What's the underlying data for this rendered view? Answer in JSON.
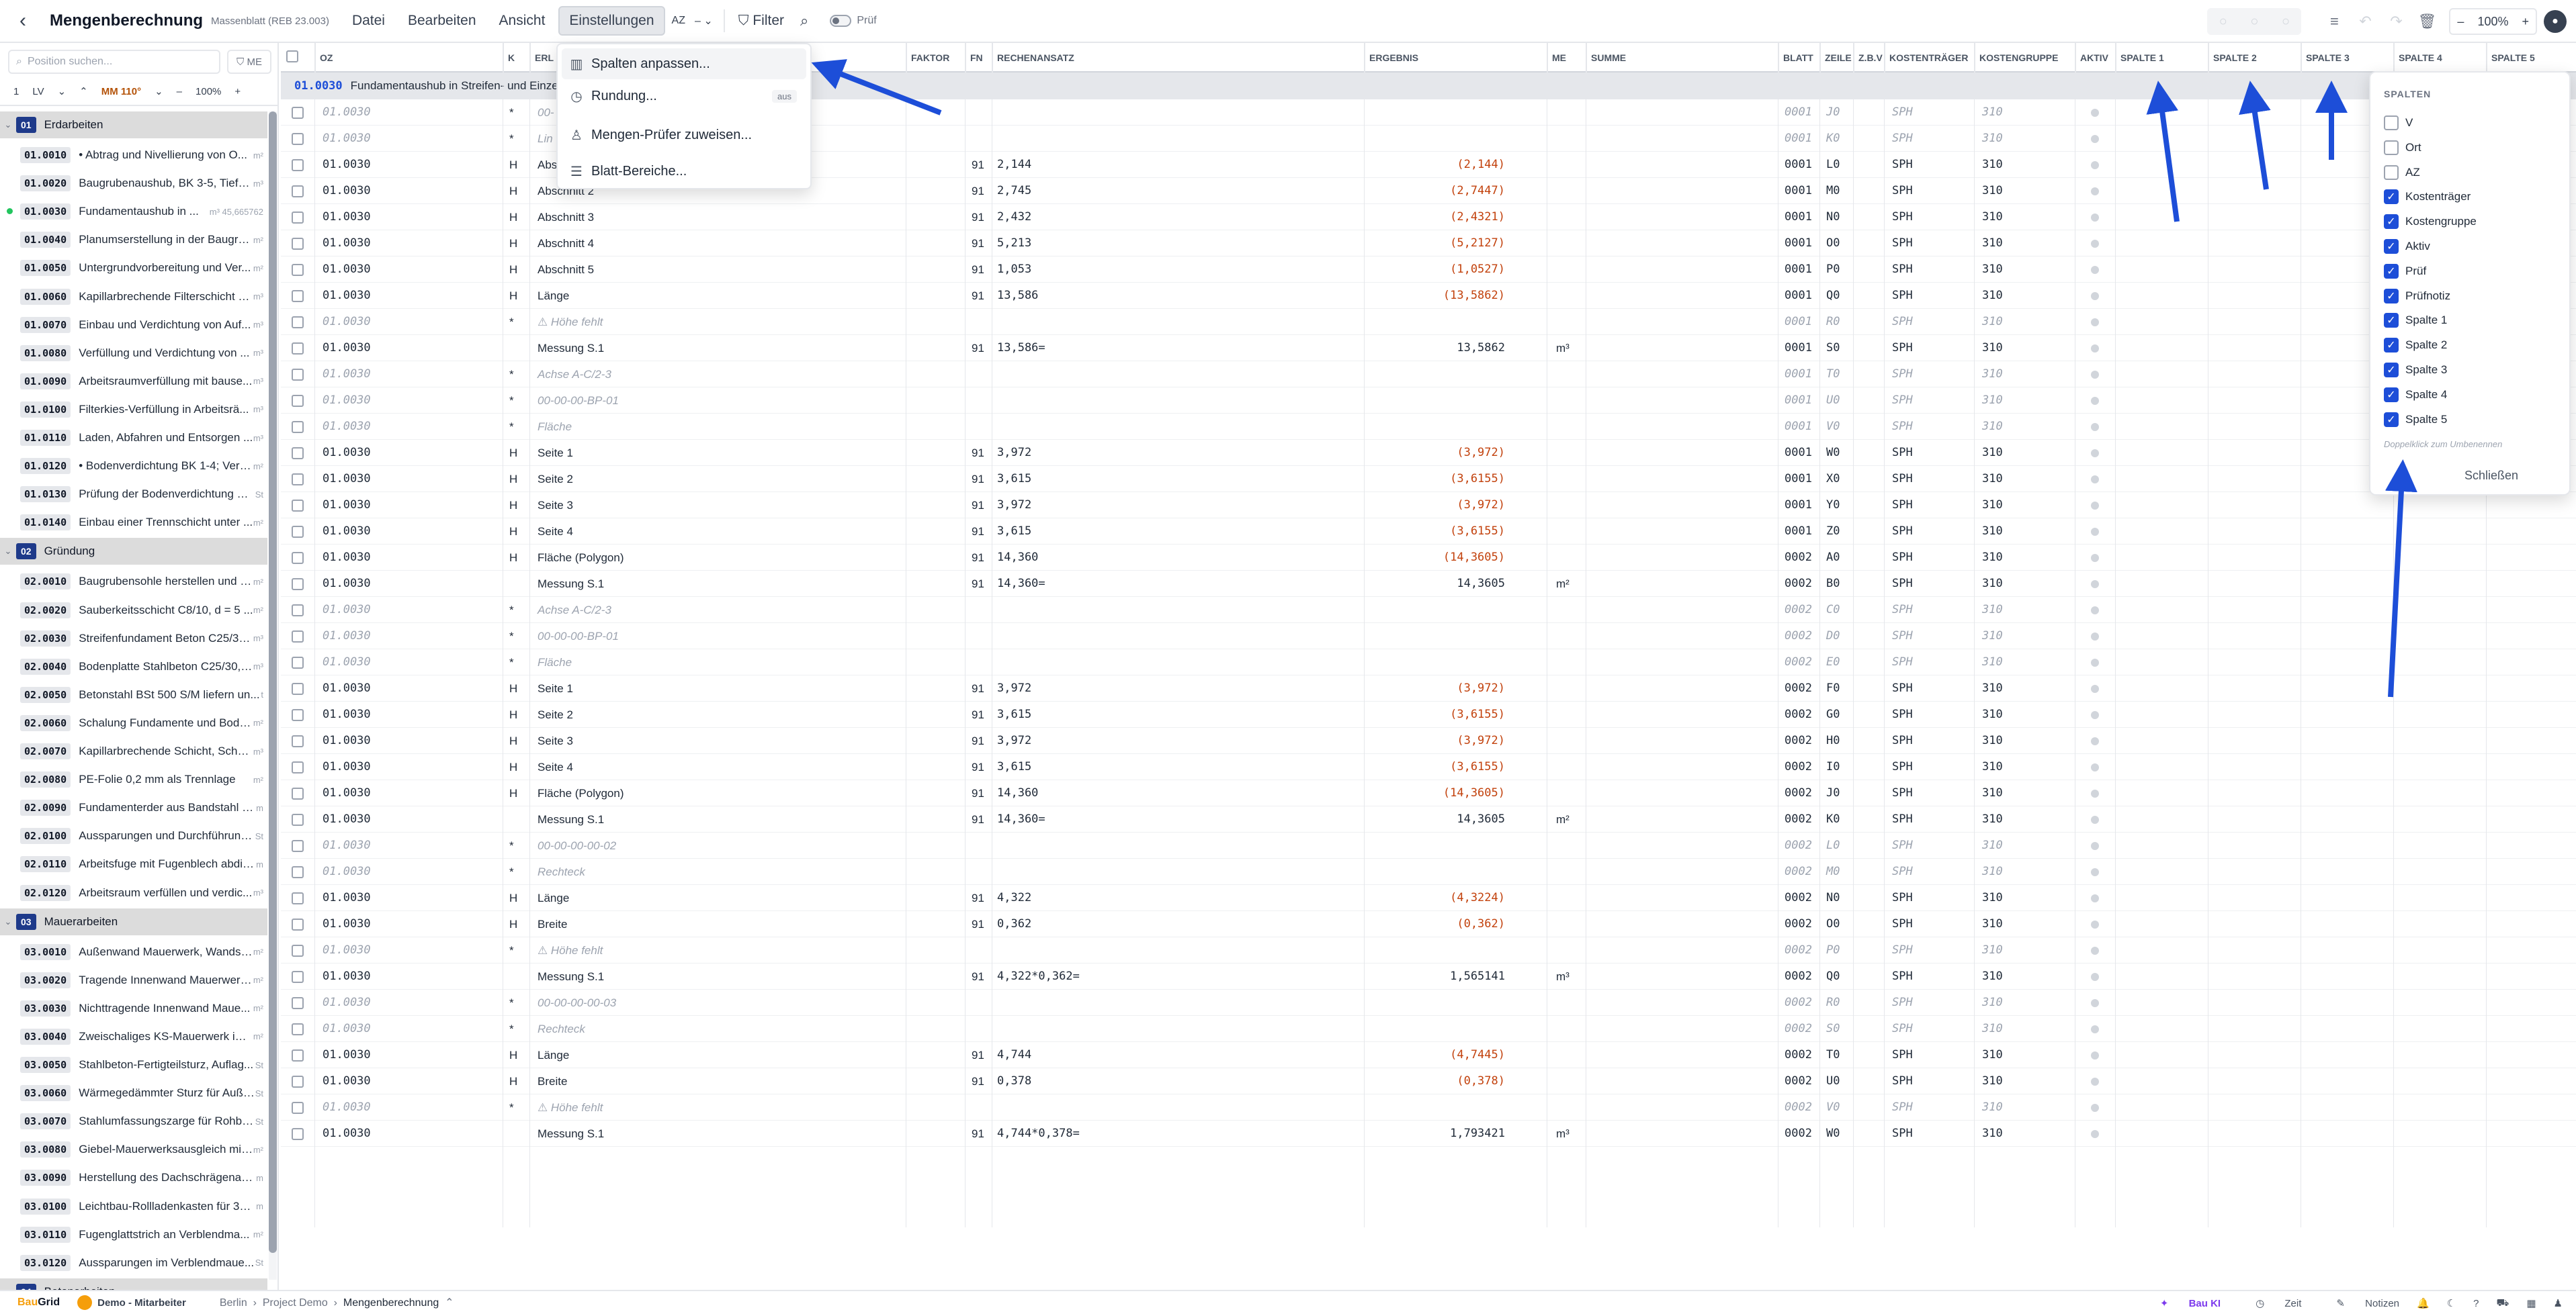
{
  "toolbar": {
    "title": "Mengenberechnung",
    "subtitle": "Massenblatt (REB 23.003)",
    "menus": [
      "Datei",
      "Bearbeiten",
      "Ansicht",
      "Einstellungen"
    ],
    "az_label": "AZ",
    "az_value": "–",
    "filter_label": "Filter",
    "pruef_label": "Prüf",
    "zoom": "100%"
  },
  "dropdown": {
    "items": [
      {
        "label": "Spalten anpassen...",
        "icon": "columns-icon"
      },
      {
        "label": "Rundung...",
        "icon": "clock-icon",
        "badge": "aus"
      },
      {
        "label": "Mengen-Prüfer zuweisen...",
        "icon": "user-icon"
      },
      {
        "label": "Blatt-Bereiche...",
        "icon": "list-icon"
      }
    ]
  },
  "sidebar": {
    "search_placeholder": "Position suchen...",
    "me_label": "ME",
    "nav": {
      "first": "1",
      "lv": "LV",
      "mm": "MM 110°",
      "minus": "–",
      "zoom": "100%",
      "plus": "+"
    },
    "sections": [
      {
        "num": "01",
        "title": "Erdarbeiten",
        "items": [
          {
            "oz": "01.0010",
            "text": "• Abtrag und Nivellierung von O...",
            "unit": "m²"
          },
          {
            "oz": "01.0020",
            "text": "Baugrubenaushub, BK 3-5, Tiefe ...",
            "unit": "m³"
          },
          {
            "oz": "01.0030",
            "text": "Fundamentaushub in ...",
            "unit": "m³ 45,665762",
            "dot": true
          },
          {
            "oz": "01.0040",
            "text": "Planumserstellung in der Baugru...",
            "unit": "m²"
          },
          {
            "oz": "01.0050",
            "text": "Untergrundvorbereitung und Ver...",
            "unit": "m²"
          },
          {
            "oz": "01.0060",
            "text": "Kapillarbrechende Filterschicht a...",
            "unit": "m³"
          },
          {
            "oz": "01.0070",
            "text": "Einbau und Verdichtung von Auf...",
            "unit": "m³"
          },
          {
            "oz": "01.0080",
            "text": "Verfüllung und Verdichtung von ...",
            "unit": "m³"
          },
          {
            "oz": "01.0090",
            "text": "Arbeitsraumverfüllung mit bause...",
            "unit": "m³"
          },
          {
            "oz": "01.0100",
            "text": "Filterkies-Verfüllung in Arbeitsrä...",
            "unit": "m³"
          },
          {
            "oz": "01.0110",
            "text": "Laden, Abfahren und Entsorgen ...",
            "unit": "m³"
          },
          {
            "oz": "01.0120",
            "text": "• Bodenverdichtung BK 1-4; Verk...",
            "unit": "m²"
          },
          {
            "oz": "01.0130",
            "text": "Prüfung der Bodenverdichtung m...",
            "unit": "St"
          },
          {
            "oz": "01.0140",
            "text": "Einbau einer Trennschicht unter ...",
            "unit": "m²"
          }
        ]
      },
      {
        "num": "02",
        "title": "Gründung",
        "items": [
          {
            "oz": "02.0010",
            "text": "Baugrubensohle herstellen und v...",
            "unit": "m²"
          },
          {
            "oz": "02.0020",
            "text": "Sauberkeitsschicht C8/10, d = 5 ...",
            "unit": "m²"
          },
          {
            "oz": "02.0030",
            "text": "Streifenfundament Beton C25/30...",
            "unit": "m³"
          },
          {
            "oz": "02.0040",
            "text": "Bodenplatte Stahlbeton C25/30, ...",
            "unit": "m³"
          },
          {
            "oz": "02.0050",
            "text": "Betonstahl BSt 500 S/M liefern un...",
            "unit": "t"
          },
          {
            "oz": "02.0060",
            "text": "Schalung Fundamente und Bode...",
            "unit": "m²"
          },
          {
            "oz": "02.0070",
            "text": "Kapillarbrechende Schicht, Schot...",
            "unit": "m³"
          },
          {
            "oz": "02.0080",
            "text": "PE-Folie 0,2 mm als Trennlage",
            "unit": "m²"
          },
          {
            "oz": "02.0090",
            "text": "Fundamenterder aus Bandstahl 3...",
            "unit": "m"
          },
          {
            "oz": "02.0100",
            "text": "Aussparungen und Durchführung...",
            "unit": "St"
          },
          {
            "oz": "02.0110",
            "text": "Arbeitsfuge mit Fugenblech abdic...",
            "unit": "m"
          },
          {
            "oz": "02.0120",
            "text": "Arbeitsraum verfüllen und verdic...",
            "unit": "m³"
          }
        ]
      },
      {
        "num": "03",
        "title": "Mauerarbeiten",
        "items": [
          {
            "oz": "03.0010",
            "text": "Außenwand Mauerwerk, Wandst...",
            "unit": "m²"
          },
          {
            "oz": "03.0020",
            "text": "Tragende Innenwand Mauerwerk...",
            "unit": "m²"
          },
          {
            "oz": "03.0030",
            "text": "Nichttragende Innenwand Maue...",
            "unit": "m²"
          },
          {
            "oz": "03.0040",
            "text": "Zweischaliges KS-Mauerwerk im ...",
            "unit": "m²"
          },
          {
            "oz": "03.0050",
            "text": "Stahlbeton-Fertigteilsturz, Auflag...",
            "unit": "St"
          },
          {
            "oz": "03.0060",
            "text": "Wärmegedämmter Sturz für Auße...",
            "unit": "St"
          },
          {
            "oz": "03.0070",
            "text": "Stahlumfassungszarge für Rohba...",
            "unit": "St"
          },
          {
            "oz": "03.0080",
            "text": "Giebel-Mauerwerksausgleich mit ...",
            "unit": "m²"
          },
          {
            "oz": "03.0090",
            "text": "Herstellung des Dachschrägenans...",
            "unit": "m"
          },
          {
            "oz": "03.0100",
            "text": "Leichtbau-Rollladenkasten für 30 ...",
            "unit": "m"
          },
          {
            "oz": "03.0110",
            "text": "Fugenglattstrich an Verblendma...",
            "unit": "m²"
          },
          {
            "oz": "03.0120",
            "text": "Aussparungen im Verblendmaue...",
            "unit": "St"
          }
        ]
      },
      {
        "num": "04",
        "title": "Betonarbeiten",
        "items": []
      }
    ]
  },
  "grid": {
    "columns": [
      "OZ",
      "K",
      "ERL",
      "FAKTOR",
      "FN",
      "RECHENANSATZ",
      "ERGEBNIS",
      "ME",
      "SUMME",
      "BLATT",
      "ZEILE",
      "Z.B.V",
      "KOSTENTRÄGER",
      "KOSTENGRUPPE",
      "AKTIV",
      "SPALTE 1",
      "SPALTE 2",
      "SPALTE 3",
      "SPALTE 4",
      "SPALTE 5"
    ],
    "group": {
      "oz": "01.0030",
      "title": "Fundamentaushub in Streifen- und Einze"
    },
    "rows": [
      {
        "oz": "01.0030",
        "k": "*",
        "erl": "00-",
        "fn": "",
        "ansatz": "",
        "erg": "",
        "me": "",
        "blatt": "0001",
        "zeile": "J0",
        "kt": "SPH",
        "kg": "310",
        "c": 1
      },
      {
        "oz": "01.0030",
        "k": "*",
        "erl": "Lin",
        "fn": "",
        "ansatz": "",
        "erg": "",
        "me": "",
        "blatt": "0001",
        "zeile": "K0",
        "kt": "SPH",
        "kg": "310",
        "c": 1
      },
      {
        "oz": "01.0030",
        "k": "H",
        "erl": "Abs",
        "fn": "91",
        "ansatz": "2,144",
        "erg": "(2,144)",
        "me": "",
        "blatt": "0001",
        "zeile": "L0",
        "kt": "SPH",
        "kg": "310",
        "o": 1
      },
      {
        "oz": "01.0030",
        "k": "H",
        "erl": "Abschnitt 2",
        "fn": "91",
        "ansatz": "2,745",
        "erg": "(2,7447)",
        "me": "",
        "blatt": "0001",
        "zeile": "M0",
        "kt": "SPH",
        "kg": "310",
        "o": 1
      },
      {
        "oz": "01.0030",
        "k": "H",
        "erl": "Abschnitt 3",
        "fn": "91",
        "ansatz": "2,432",
        "erg": "(2,4321)",
        "me": "",
        "blatt": "0001",
        "zeile": "N0",
        "kt": "SPH",
        "kg": "310",
        "o": 1
      },
      {
        "oz": "01.0030",
        "k": "H",
        "erl": "Abschnitt 4",
        "fn": "91",
        "ansatz": "5,213",
        "erg": "(5,2127)",
        "me": "",
        "blatt": "0001",
        "zeile": "O0",
        "kt": "SPH",
        "kg": "310",
        "o": 1
      },
      {
        "oz": "01.0030",
        "k": "H",
        "erl": "Abschnitt 5",
        "fn": "91",
        "ansatz": "1,053",
        "erg": "(1,0527)",
        "me": "",
        "blatt": "0001",
        "zeile": "P0",
        "kt": "SPH",
        "kg": "310",
        "o": 1
      },
      {
        "oz": "01.0030",
        "k": "H",
        "erl": "Länge",
        "fn": "91",
        "ansatz": "13,586",
        "erg": "(13,5862)",
        "me": "",
        "blatt": "0001",
        "zeile": "Q0",
        "kt": "SPH",
        "kg": "310",
        "o": 1
      },
      {
        "oz": "01.0030",
        "k": "*",
        "erl": "⚠ Höhe fehlt",
        "fn": "",
        "ansatz": "",
        "erg": "",
        "me": "",
        "blatt": "0001",
        "zeile": "R0",
        "kt": "SPH",
        "kg": "310",
        "c": 1
      },
      {
        "oz": "01.0030",
        "k": "",
        "erl": "Messung S.1",
        "fn": "91",
        "ansatz": "13,586=",
        "erg": "13,5862",
        "me": "m³",
        "blatt": "0001",
        "zeile": "S0",
        "kt": "SPH",
        "kg": "310"
      },
      {
        "oz": "01.0030",
        "k": "*",
        "erl": "Achse A-C/2-3",
        "fn": "",
        "ansatz": "",
        "erg": "",
        "me": "",
        "blatt": "0001",
        "zeile": "T0",
        "kt": "SPH",
        "kg": "310",
        "c": 1
      },
      {
        "oz": "01.0030",
        "k": "*",
        "erl": "00-00-00-BP-01",
        "fn": "",
        "ansatz": "",
        "erg": "",
        "me": "",
        "blatt": "0001",
        "zeile": "U0",
        "kt": "SPH",
        "kg": "310",
        "c": 1
      },
      {
        "oz": "01.0030",
        "k": "*",
        "erl": "Fläche",
        "fn": "",
        "ansatz": "",
        "erg": "",
        "me": "",
        "blatt": "0001",
        "zeile": "V0",
        "kt": "SPH",
        "kg": "310",
        "c": 1
      },
      {
        "oz": "01.0030",
        "k": "H",
        "erl": "Seite 1",
        "fn": "91",
        "ansatz": "3,972",
        "erg": "(3,972)",
        "me": "",
        "blatt": "0001",
        "zeile": "W0",
        "kt": "SPH",
        "kg": "310",
        "o": 1
      },
      {
        "oz": "01.0030",
        "k": "H",
        "erl": "Seite 2",
        "fn": "91",
        "ansatz": "3,615",
        "erg": "(3,6155)",
        "me": "",
        "blatt": "0001",
        "zeile": "X0",
        "kt": "SPH",
        "kg": "310",
        "o": 1
      },
      {
        "oz": "01.0030",
        "k": "H",
        "erl": "Seite 3",
        "fn": "91",
        "ansatz": "3,972",
        "erg": "(3,972)",
        "me": "",
        "blatt": "0001",
        "zeile": "Y0",
        "kt": "SPH",
        "kg": "310",
        "o": 1
      },
      {
        "oz": "01.0030",
        "k": "H",
        "erl": "Seite 4",
        "fn": "91",
        "ansatz": "3,615",
        "erg": "(3,6155)",
        "me": "",
        "blatt": "0001",
        "zeile": "Z0",
        "kt": "SPH",
        "kg": "310",
        "o": 1
      },
      {
        "oz": "01.0030",
        "k": "H",
        "erl": "Fläche (Polygon)",
        "fn": "91",
        "ansatz": "14,360",
        "erg": "(14,3605)",
        "me": "",
        "blatt": "0002",
        "zeile": "A0",
        "kt": "SPH",
        "kg": "310",
        "o": 1
      },
      {
        "oz": "01.0030",
        "k": "",
        "erl": "Messung S.1",
        "fn": "91",
        "ansatz": "14,360=",
        "erg": "14,3605",
        "me": "m²",
        "blatt": "0002",
        "zeile": "B0",
        "kt": "SPH",
        "kg": "310"
      },
      {
        "oz": "01.0030",
        "k": "*",
        "erl": "Achse A-C/2-3",
        "fn": "",
        "ansatz": "",
        "erg": "",
        "me": "",
        "blatt": "0002",
        "zeile": "C0",
        "kt": "SPH",
        "kg": "310",
        "c": 1
      },
      {
        "oz": "01.0030",
        "k": "*",
        "erl": "00-00-00-BP-01",
        "fn": "",
        "ansatz": "",
        "erg": "",
        "me": "",
        "blatt": "0002",
        "zeile": "D0",
        "kt": "SPH",
        "kg": "310",
        "c": 1
      },
      {
        "oz": "01.0030",
        "k": "*",
        "erl": "Fläche",
        "fn": "",
        "ansatz": "",
        "erg": "",
        "me": "",
        "blatt": "0002",
        "zeile": "E0",
        "kt": "SPH",
        "kg": "310",
        "c": 1
      },
      {
        "oz": "01.0030",
        "k": "H",
        "erl": "Seite 1",
        "fn": "91",
        "ansatz": "3,972",
        "erg": "(3,972)",
        "me": "",
        "blatt": "0002",
        "zeile": "F0",
        "kt": "SPH",
        "kg": "310",
        "o": 1
      },
      {
        "oz": "01.0030",
        "k": "H",
        "erl": "Seite 2",
        "fn": "91",
        "ansatz": "3,615",
        "erg": "(3,6155)",
        "me": "",
        "blatt": "0002",
        "zeile": "G0",
        "kt": "SPH",
        "kg": "310",
        "o": 1
      },
      {
        "oz": "01.0030",
        "k": "H",
        "erl": "Seite 3",
        "fn": "91",
        "ansatz": "3,972",
        "erg": "(3,972)",
        "me": "",
        "blatt": "0002",
        "zeile": "H0",
        "kt": "SPH",
        "kg": "310",
        "o": 1
      },
      {
        "oz": "01.0030",
        "k": "H",
        "erl": "Seite 4",
        "fn": "91",
        "ansatz": "3,615",
        "erg": "(3,6155)",
        "me": "",
        "blatt": "0002",
        "zeile": "I0",
        "kt": "SPH",
        "kg": "310",
        "o": 1
      },
      {
        "oz": "01.0030",
        "k": "H",
        "erl": "Fläche (Polygon)",
        "fn": "91",
        "ansatz": "14,360",
        "erg": "(14,3605)",
        "me": "",
        "blatt": "0002",
        "zeile": "J0",
        "kt": "SPH",
        "kg": "310",
        "o": 1
      },
      {
        "oz": "01.0030",
        "k": "",
        "erl": "Messung S.1",
        "fn": "91",
        "ansatz": "14,360=",
        "erg": "14,3605",
        "me": "m²",
        "blatt": "0002",
        "zeile": "K0",
        "kt": "SPH",
        "kg": "310"
      },
      {
        "oz": "01.0030",
        "k": "*",
        "erl": "00-00-00-00-02",
        "fn": "",
        "ansatz": "",
        "erg": "",
        "me": "",
        "blatt": "0002",
        "zeile": "L0",
        "kt": "SPH",
        "kg": "310",
        "c": 1
      },
      {
        "oz": "01.0030",
        "k": "*",
        "erl": "Rechteck",
        "fn": "",
        "ansatz": "",
        "erg": "",
        "me": "",
        "blatt": "0002",
        "zeile": "M0",
        "kt": "SPH",
        "kg": "310",
        "c": 1
      },
      {
        "oz": "01.0030",
        "k": "H",
        "erl": "Länge",
        "fn": "91",
        "ansatz": "4,322",
        "erg": "(4,3224)",
        "me": "",
        "blatt": "0002",
        "zeile": "N0",
        "kt": "SPH",
        "kg": "310",
        "o": 1
      },
      {
        "oz": "01.0030",
        "k": "H",
        "erl": "Breite",
        "fn": "91",
        "ansatz": "0,362",
        "erg": "(0,362)",
        "me": "",
        "blatt": "0002",
        "zeile": "O0",
        "kt": "SPH",
        "kg": "310",
        "o": 1
      },
      {
        "oz": "01.0030",
        "k": "*",
        "erl": "⚠ Höhe fehlt",
        "fn": "",
        "ansatz": "",
        "erg": "",
        "me": "",
        "blatt": "0002",
        "zeile": "P0",
        "kt": "SPH",
        "kg": "310",
        "c": 1
      },
      {
        "oz": "01.0030",
        "k": "",
        "erl": "Messung S.1",
        "fn": "91",
        "ansatz": "4,322*0,362=",
        "erg": "1,565141",
        "me": "m³",
        "blatt": "0002",
        "zeile": "Q0",
        "kt": "SPH",
        "kg": "310"
      },
      {
        "oz": "01.0030",
        "k": "*",
        "erl": "00-00-00-00-03",
        "fn": "",
        "ansatz": "",
        "erg": "",
        "me": "",
        "blatt": "0002",
        "zeile": "R0",
        "kt": "SPH",
        "kg": "310",
        "c": 1
      },
      {
        "oz": "01.0030",
        "k": "*",
        "erl": "Rechteck",
        "fn": "",
        "ansatz": "",
        "erg": "",
        "me": "",
        "blatt": "0002",
        "zeile": "S0",
        "kt": "SPH",
        "kg": "310",
        "c": 1
      },
      {
        "oz": "01.0030",
        "k": "H",
        "erl": "Länge",
        "fn": "91",
        "ansatz": "4,744",
        "erg": "(4,7445)",
        "me": "",
        "blatt": "0002",
        "zeile": "T0",
        "kt": "SPH",
        "kg": "310",
        "o": 1
      },
      {
        "oz": "01.0030",
        "k": "H",
        "erl": "Breite",
        "fn": "91",
        "ansatz": "0,378",
        "erg": "(0,378)",
        "me": "",
        "blatt": "0002",
        "zeile": "U0",
        "kt": "SPH",
        "kg": "310",
        "o": 1
      },
      {
        "oz": "01.0030",
        "k": "*",
        "erl": "⚠ Höhe fehlt",
        "fn": "",
        "ansatz": "",
        "erg": "",
        "me": "",
        "blatt": "0002",
        "zeile": "V0",
        "kt": "SPH",
        "kg": "310",
        "c": 1
      },
      {
        "oz": "01.0030",
        "k": "",
        "erl": "Messung S.1",
        "fn": "91",
        "ansatz": "4,744*0,378=",
        "erg": "1,793421",
        "me": "m³",
        "blatt": "0002",
        "zeile": "W0",
        "kt": "SPH",
        "kg": "310"
      }
    ]
  },
  "columns_panel": {
    "title": "SPALTEN",
    "items": [
      {
        "label": "V",
        "checked": false
      },
      {
        "label": "Ort",
        "checked": false
      },
      {
        "label": "AZ",
        "checked": false
      },
      {
        "label": "Kostenträger",
        "checked": true
      },
      {
        "label": "Kostengruppe",
        "checked": true
      },
      {
        "label": "Aktiv",
        "checked": true
      },
      {
        "label": "Prüf",
        "checked": true
      },
      {
        "label": "Prüfnotiz",
        "checked": true
      },
      {
        "label": "Spalte 1",
        "checked": true
      },
      {
        "label": "Spalte 2",
        "checked": true
      },
      {
        "label": "Spalte 3",
        "checked": true
      },
      {
        "label": "Spalte 4",
        "checked": true
      },
      {
        "label": "Spalte 5",
        "checked": true
      }
    ],
    "hint": "Doppelklick zum Umbenennen",
    "close_label": "Schließen"
  },
  "statusbar": {
    "logo_a": "Bau",
    "logo_b": "Grid",
    "user": "Demo - Mitarbeiter",
    "breadcrumb": [
      "Berlin",
      "Project Demo",
      "Mengenberechnung"
    ],
    "right": [
      "Bau KI",
      "Zeit",
      "Notizen"
    ]
  },
  "colors": {
    "accent": "#1d4ed8",
    "orange": "#c2410c",
    "annotation_arrow": "#1d4ed8"
  }
}
